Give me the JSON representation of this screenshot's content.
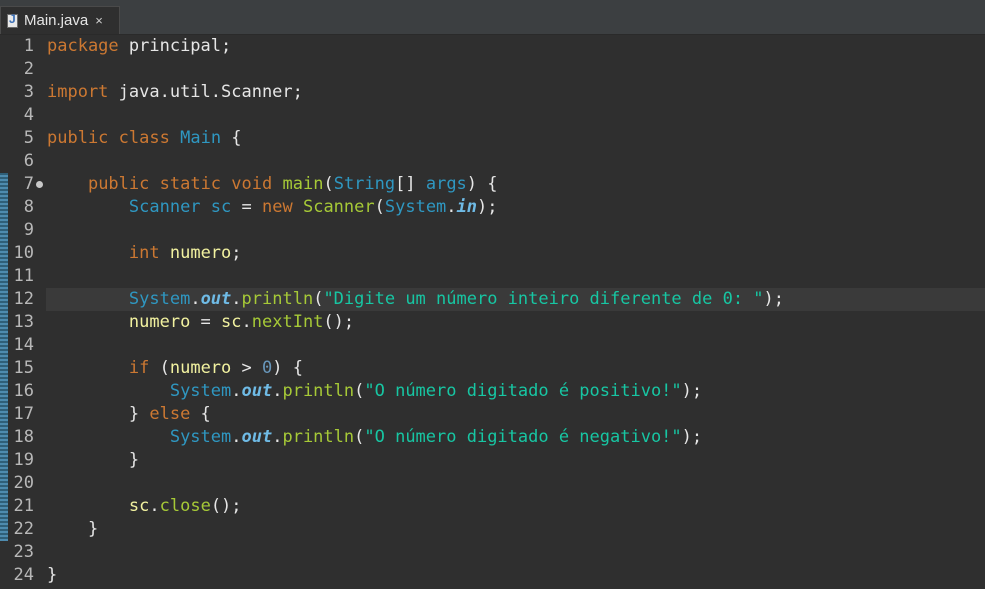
{
  "tab": {
    "title": "Main.java",
    "close_symbol": "×",
    "icon": "java-file-icon"
  },
  "colors": {
    "keyword": "#cc7832",
    "type": "#2f97c1",
    "method": "#a6c937",
    "string": "#17c6a3",
    "static_field": "#6fbbe6",
    "background": "#2f2f2f"
  },
  "editor": {
    "current_line": 12,
    "line_numbers": [
      "1",
      "2",
      "3",
      "4",
      "5",
      "6",
      "7",
      "8",
      "9",
      "10",
      "11",
      "12",
      "13",
      "14",
      "15",
      "16",
      "17",
      "18",
      "19",
      "20",
      "21",
      "22",
      "23",
      "24"
    ],
    "lines": [
      [
        [
          "kw",
          "package"
        ],
        [
          "pl",
          " principal;"
        ]
      ],
      [],
      [
        [
          "kw",
          "import"
        ],
        [
          "pl",
          " java.util.Scanner;"
        ]
      ],
      [],
      [
        [
          "kw",
          "public"
        ],
        [
          "pl",
          " "
        ],
        [
          "kw",
          "class"
        ],
        [
          "pl",
          " "
        ],
        [
          "tp",
          "Main"
        ],
        [
          "pl",
          " {"
        ]
      ],
      [],
      [
        [
          "pl",
          "    "
        ],
        [
          "kw",
          "public"
        ],
        [
          "pl",
          " "
        ],
        [
          "kw",
          "static"
        ],
        [
          "pl",
          " "
        ],
        [
          "kw",
          "void"
        ],
        [
          "pl",
          " "
        ],
        [
          "fn",
          "main"
        ],
        [
          "pl",
          "("
        ],
        [
          "tp",
          "String"
        ],
        [
          "pl",
          "[] "
        ],
        [
          "tp",
          "args"
        ],
        [
          "pl",
          ") {"
        ]
      ],
      [
        [
          "pl",
          "        "
        ],
        [
          "tp",
          "Scanner"
        ],
        [
          "pl",
          " "
        ],
        [
          "tp",
          "sc"
        ],
        [
          "pl",
          " = "
        ],
        [
          "kw",
          "new"
        ],
        [
          "pl",
          " "
        ],
        [
          "fn",
          "Scanner"
        ],
        [
          "pl",
          "("
        ],
        [
          "tp",
          "System"
        ],
        [
          "pl",
          "."
        ],
        [
          "sf",
          "in"
        ],
        [
          "pl",
          ");"
        ]
      ],
      [],
      [
        [
          "pl",
          "        "
        ],
        [
          "kw",
          "int"
        ],
        [
          "pl",
          " "
        ],
        [
          "vr",
          "numero"
        ],
        [
          "pl",
          ";"
        ]
      ],
      [],
      [
        [
          "pl",
          "        "
        ],
        [
          "tp",
          "System"
        ],
        [
          "pl",
          "."
        ],
        [
          "sf",
          "out"
        ],
        [
          "pl",
          "."
        ],
        [
          "fn",
          "println"
        ],
        [
          "pl",
          "("
        ],
        [
          "str",
          "\"Digite um número inteiro diferente de 0: \""
        ],
        [
          "pl",
          ");"
        ]
      ],
      [
        [
          "pl",
          "        "
        ],
        [
          "vr",
          "numero"
        ],
        [
          "pl",
          " = "
        ],
        [
          "vr",
          "sc"
        ],
        [
          "pl",
          "."
        ],
        [
          "fn",
          "nextInt"
        ],
        [
          "pl",
          "();"
        ]
      ],
      [],
      [
        [
          "pl",
          "        "
        ],
        [
          "kw",
          "if"
        ],
        [
          "pl",
          " ("
        ],
        [
          "vr",
          "numero"
        ],
        [
          "pl",
          " > "
        ],
        [
          "num",
          "0"
        ],
        [
          "pl",
          ") {"
        ]
      ],
      [
        [
          "pl",
          "            "
        ],
        [
          "tp",
          "System"
        ],
        [
          "pl",
          "."
        ],
        [
          "sf",
          "out"
        ],
        [
          "pl",
          "."
        ],
        [
          "fn",
          "println"
        ],
        [
          "pl",
          "("
        ],
        [
          "str",
          "\"O número digitado é positivo!\""
        ],
        [
          "pl",
          ");"
        ]
      ],
      [
        [
          "pl",
          "        } "
        ],
        [
          "kw",
          "else"
        ],
        [
          "pl",
          " {"
        ]
      ],
      [
        [
          "pl",
          "            "
        ],
        [
          "tp",
          "System"
        ],
        [
          "pl",
          "."
        ],
        [
          "sf",
          "out"
        ],
        [
          "pl",
          "."
        ],
        [
          "fn",
          "println"
        ],
        [
          "pl",
          "("
        ],
        [
          "str",
          "\"O número digitado é negativo!\""
        ],
        [
          "pl",
          ");"
        ]
      ],
      [
        [
          "pl",
          "        }"
        ]
      ],
      [],
      [
        [
          "pl",
          "        "
        ],
        [
          "vr",
          "sc"
        ],
        [
          "pl",
          "."
        ],
        [
          "fn",
          "close"
        ],
        [
          "pl",
          "();"
        ]
      ],
      [
        [
          "pl",
          "    }"
        ]
      ],
      [],
      [
        [
          "pl",
          "}"
        ]
      ]
    ]
  }
}
